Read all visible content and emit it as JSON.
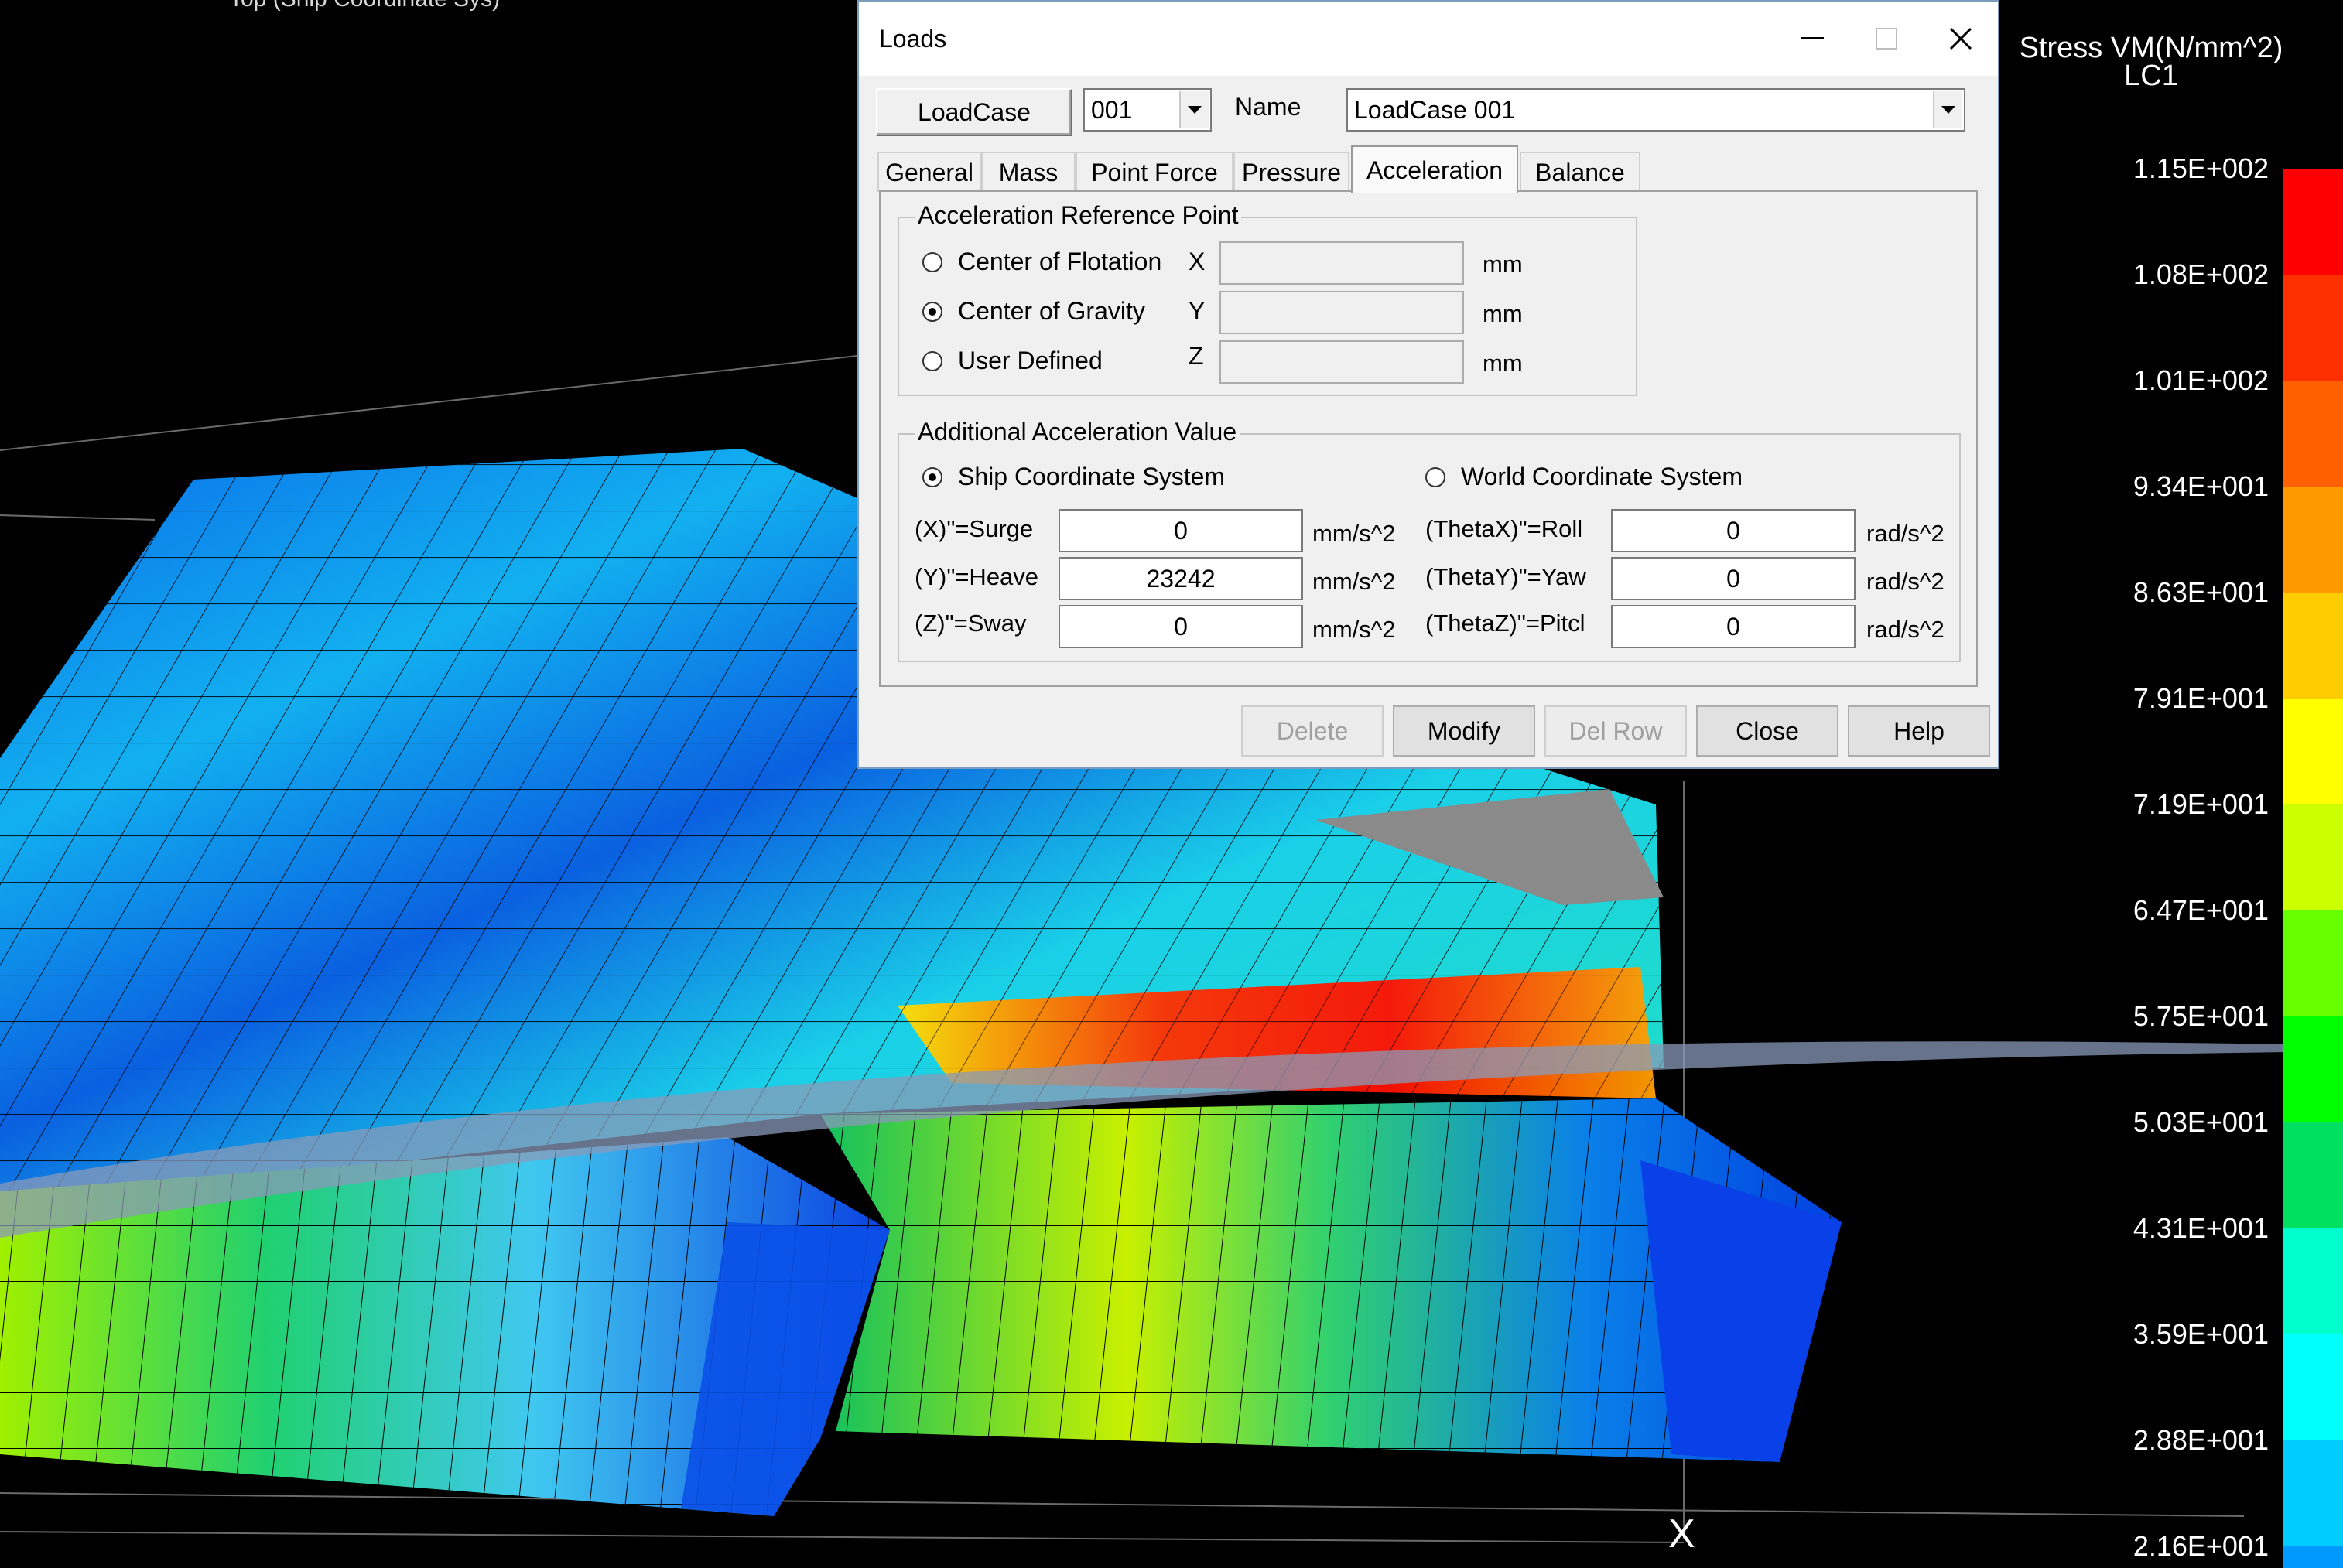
{
  "viewport": {
    "top_caption": "Top (Ship Coordinate Sys)",
    "axis_label": "X"
  },
  "legend": {
    "title": "Stress VM(N/mm^2)\nLC1",
    "labels": [
      "1.15E+002",
      "1.08E+002",
      "1.01E+002",
      "9.34E+001",
      "8.63E+001",
      "7.91E+001",
      "7.19E+001",
      "6.47E+001",
      "5.75E+001",
      "5.03E+001",
      "4.31E+001",
      "3.59E+001",
      "2.88E+001",
      "2.16E+001"
    ],
    "colors": [
      "#ff0000",
      "#ff3000",
      "#ff6000",
      "#ff9900",
      "#ffcc00",
      "#ffff00",
      "#ccff00",
      "#66ff00",
      "#00ff00",
      "#00e060",
      "#00ffcc",
      "#00ffff",
      "#00ccff",
      "#0099ff"
    ]
  },
  "dialog": {
    "title": "Loads",
    "loadcase_button": "LoadCase",
    "loadcase_value": "001",
    "name_label": "Name",
    "name_value": "LoadCase 001",
    "tabs": [
      "General",
      "Mass",
      "Point Force",
      "Pressure",
      "Acceleration",
      "Balance"
    ],
    "active_tab": "Acceleration",
    "ref_point": {
      "title": "Acceleration Reference Point",
      "options": [
        "Center of Flotation",
        "Center of Gravity",
        "User Defined"
      ],
      "selected": "Center of Gravity",
      "axes": [
        "X",
        "Y",
        "Z"
      ],
      "values": [
        "",
        "",
        ""
      ],
      "unit": "mm"
    },
    "additional": {
      "title": "Additional Acceleration Value",
      "systems": [
        "Ship Coordinate System",
        "World Coordinate System"
      ],
      "selected": "Ship Coordinate System",
      "linear": [
        {
          "label": "(X)\"=Surge",
          "value": "0",
          "unit": "mm/s^2"
        },
        {
          "label": "(Y)\"=Heave",
          "value": "23242",
          "unit": "mm/s^2"
        },
        {
          "label": "(Z)\"=Sway",
          "value": "0",
          "unit": "mm/s^2"
        }
      ],
      "angular": [
        {
          "label": "(ThetaX)\"=Roll",
          "value": "0",
          "unit": "rad/s^2"
        },
        {
          "label": "(ThetaY)\"=Yaw",
          "value": "0",
          "unit": "rad/s^2"
        },
        {
          "label": "(ThetaZ)\"=Pitcl",
          "value": "0",
          "unit": "rad/s^2"
        }
      ]
    },
    "buttons": {
      "delete": "Delete",
      "modify": "Modify",
      "delrow": "Del Row",
      "close": "Close",
      "help": "Help"
    }
  }
}
